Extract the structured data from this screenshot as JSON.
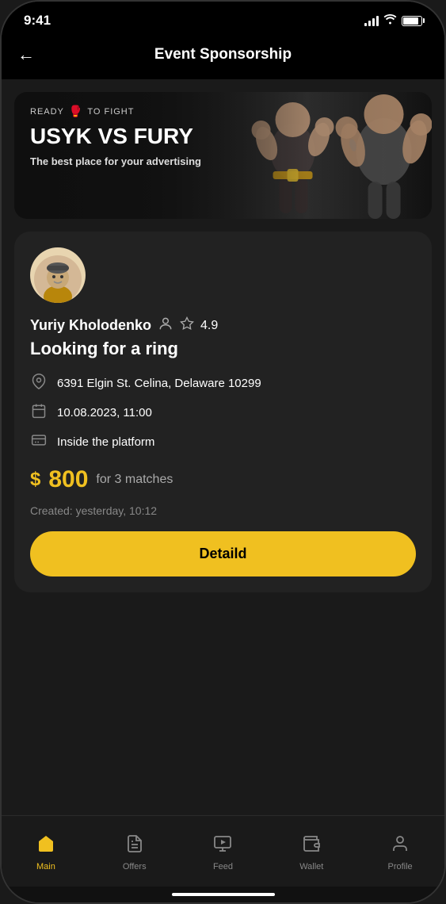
{
  "statusBar": {
    "time": "9:41"
  },
  "header": {
    "title": "Event Sponsorship",
    "backLabel": "←"
  },
  "banner": {
    "tag": "READY",
    "tagIcon": "🥊",
    "tagSuffix": "TO FIGHT",
    "title": "USYK VS FURY",
    "subtitle": "The best place for your advertising"
  },
  "card": {
    "userName": "Yuriy Kholodenko",
    "rating": "4.9",
    "listingTitle": "Looking for a ring",
    "location": "6391 Elgin St. Celina, Delaware 10299",
    "datetime": "10.08.2023, 11:00",
    "paymentType": "Inside the platform",
    "priceAmount": "800",
    "priceSuffix": "for 3 matches",
    "createdText": "Created: yesterday, 10:12",
    "buttonLabel": "Detaild"
  },
  "bottomNav": {
    "items": [
      {
        "id": "main",
        "label": "Main",
        "active": true
      },
      {
        "id": "offers",
        "label": "Offers",
        "active": false
      },
      {
        "id": "feed",
        "label": "Feed",
        "active": false
      },
      {
        "id": "wallet",
        "label": "Wallet",
        "active": false
      },
      {
        "id": "profile",
        "label": "Profile",
        "active": false
      }
    ]
  },
  "colors": {
    "accent": "#f0c020",
    "background": "#111111",
    "card": "#222222",
    "text": "#ffffff",
    "muted": "#888888"
  }
}
